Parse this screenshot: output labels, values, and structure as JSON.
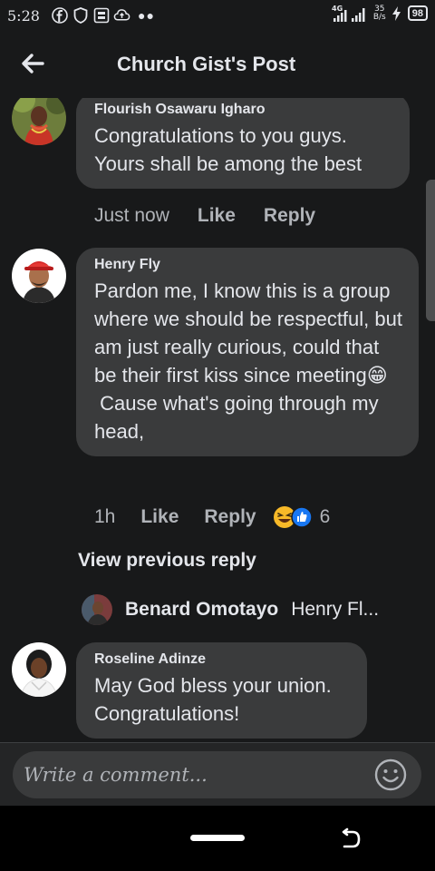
{
  "status_bar": {
    "time": "5:28",
    "network_label": "4G",
    "speed_value": "35",
    "speed_unit": "B/s",
    "battery": "98"
  },
  "header": {
    "title": "Church Gist's Post"
  },
  "comments": [
    {
      "author": "Flourish Osawaru Igharo",
      "text": "Congratulations to you guys.\nYours shall be among the best",
      "time": "Just now",
      "like_label": "Like",
      "reply_label": "Reply"
    },
    {
      "author": "Henry Fly",
      "text": "Pardon me, I know this is a group where we should be respectful, but am just really curious, could that be their first kiss since meeting😁\n Cause what's going through my head,",
      "time": "1h",
      "like_label": "Like",
      "reply_label": "Reply",
      "reaction_count": "6",
      "reactions": [
        "haha",
        "like"
      ]
    },
    {
      "author": "Roseline Adinze",
      "text": "May God bless your union.\nCongratulations!"
    }
  ],
  "view_previous": "View previous reply",
  "reply_preview": {
    "author": "Benard Omotayo",
    "snippet": "Henry Fl..."
  },
  "composer": {
    "placeholder": "Write a comment..."
  },
  "colors": {
    "background": "#18191a",
    "bubble": "#3a3b3c",
    "text": "#e4e6eb",
    "muted": "#b0b3b8",
    "like_blue": "#1877f2",
    "haha_yellow": "#f7b928"
  },
  "icons": {
    "back": "arrow-left-icon",
    "emoji": "smiley-icon",
    "statusbar": [
      "facebook-icon",
      "shield-icon",
      "image-icon",
      "cloud-upload-icon",
      "signal-icon",
      "flash-icon",
      "battery-icon"
    ]
  }
}
